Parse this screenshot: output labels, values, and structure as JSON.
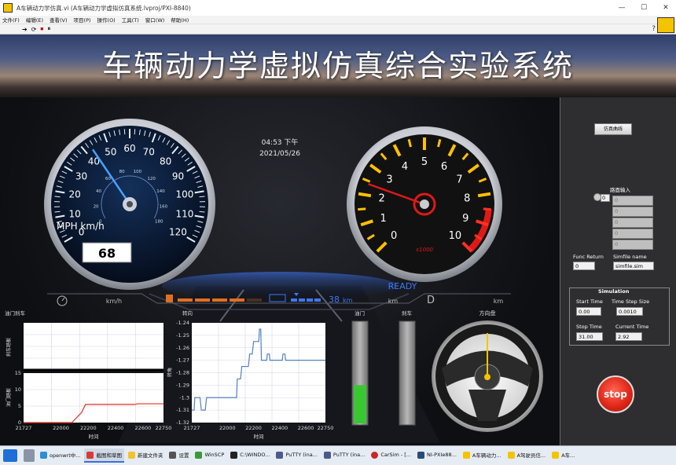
{
  "window": {
    "title": "A车辆动力学仿真.vi (A车辆动力学虚拟仿真系统.lvproj/PXI-8840)",
    "minimize": "—",
    "maximize": "☐",
    "close": "✕"
  },
  "menu": [
    "文件(F)",
    "编辑(E)",
    "查看(V)",
    "项目(P)",
    "操作(O)",
    "工具(T)",
    "窗口(W)",
    "帮助(H)"
  ],
  "toolbar": {
    "run": "➔",
    "run_continuous": "⟳",
    "abort": "⏹",
    "pause": "⏸",
    "help": "?"
  },
  "banner": {
    "title": "车辆动力学虚拟仿真综合实验系统"
  },
  "clock": {
    "time": "04:53 下午",
    "date": "2021/05/26"
  },
  "speedometer": {
    "outer_ticks": [
      "0",
      "10",
      "20",
      "30",
      "40",
      "50",
      "60",
      "70",
      "80",
      "90",
      "100",
      "110",
      "120"
    ],
    "inner_ticks": [
      "0",
      "20",
      "40",
      "60",
      "80",
      "100",
      "120",
      "140",
      "160",
      "180"
    ],
    "unit": "MPH km/h",
    "value": "68",
    "needle_mph": 43
  },
  "tachometer": {
    "ticks": [
      "0",
      "1",
      "2",
      "3",
      "4",
      "5",
      "6",
      "7",
      "8",
      "9",
      "10"
    ],
    "unit": "x1000",
    "value_k": 2.4
  },
  "status": {
    "ready": "READY",
    "speed_unit": "km/h",
    "range": "38",
    "range_unit": "km",
    "km": "km",
    "gear": "D",
    "km2": "km",
    "fuel_level": 0.72
  },
  "colors": {
    "accent_blue": "#3c78ff",
    "tick_red": "#ff2020",
    "tick_yellow": "#ffc000",
    "bar_orange": "#e07020",
    "bar_green": "#3ac832",
    "plot_line": "#e03020",
    "plot_line2": "#5080c0"
  },
  "chart_data": [
    {
      "type": "line",
      "title": "油门刹车",
      "ylabel": "刹车踏板",
      "xlabel": "时间",
      "x_ticks": [
        "21727",
        "22000",
        "22200",
        "22400",
        "22600",
        "22750"
      ],
      "ylim": [
        0,
        1
      ],
      "series": [
        {
          "values": [
            [
              21727,
              0
            ],
            [
              22750,
              0
            ]
          ]
        }
      ]
    },
    {
      "type": "line",
      "ylabel": "油门踏板",
      "xlabel": "时间",
      "y_ticks": [
        "15",
        "10",
        "5",
        "0"
      ],
      "x_ticks": [
        "21727",
        "22000",
        "22200",
        "22400",
        "22600",
        "22750"
      ],
      "ylim": [
        0,
        15
      ],
      "series": [
        {
          "values": [
            [
              21727,
              0
            ],
            [
              22080,
              0
            ],
            [
              22150,
              3
            ],
            [
              22180,
              5.5
            ],
            [
              22540,
              5.5
            ],
            [
              22560,
              5.7
            ],
            [
              22750,
              5.7
            ]
          ]
        }
      ]
    },
    {
      "type": "line",
      "title": "转向",
      "ylabel": "转角",
      "xlabel": "时间",
      "y_ticks": [
        "-1.24",
        "-1.25",
        "-1.26",
        "-1.27",
        "-1.28",
        "-1.29",
        "-1.3",
        "-1.31",
        "-1.32"
      ],
      "x_ticks": [
        "21727",
        "22000",
        "22200",
        "22400",
        "22600",
        "22750"
      ],
      "ylim": [
        -1.32,
        -1.24
      ],
      "series": [
        {
          "values": [
            [
              21727,
              -1.31
            ],
            [
              21745,
              -1.31
            ],
            [
              21750,
              -1.3
            ],
            [
              21790,
              -1.3
            ],
            [
              21800,
              -1.31
            ],
            [
              21830,
              -1.31
            ],
            [
              21840,
              -1.3
            ],
            [
              22070,
              -1.3
            ],
            [
              22075,
              -1.285
            ],
            [
              22100,
              -1.285
            ],
            [
              22110,
              -1.275
            ],
            [
              22160,
              -1.275
            ],
            [
              22170,
              -1.265
            ],
            [
              22190,
              -1.265
            ],
            [
              22200,
              -1.255
            ],
            [
              22240,
              -1.255
            ],
            [
              22245,
              -1.245
            ],
            [
              22255,
              -1.245
            ],
            [
              22260,
              -1.27
            ],
            [
              22300,
              -1.27
            ],
            [
              22305,
              -1.265
            ],
            [
              22320,
              -1.265
            ],
            [
              22325,
              -1.27
            ],
            [
              22420,
              -1.27
            ],
            [
              22425,
              -1.265
            ],
            [
              22440,
              -1.265
            ],
            [
              22445,
              -1.27
            ],
            [
              22750,
              -1.27
            ]
          ]
        }
      ]
    },
    {
      "type": "bar",
      "title": "油门",
      "values": [
        0.38
      ]
    },
    {
      "type": "bar",
      "title": "刹车",
      "values": [
        0.0
      ]
    }
  ],
  "steering": {
    "title": "方向盘"
  },
  "right_panel": {
    "sim_button": "仿真曲线",
    "path_input_label": "路面输入",
    "path_index": "0",
    "path_values": [
      "0",
      "0",
      "0",
      "0",
      "0"
    ],
    "func_return_label": "Func Return",
    "func_return": "0",
    "simfile_label": "Simfile name",
    "simfile": "simfile.sim",
    "sim_title": "Simulation",
    "start_time_label": "Start Time",
    "start_time": "0.00",
    "time_step_label": "Time Step Size",
    "time_step": "0.0010",
    "stop_time_label": "Stop Time",
    "stop_time": "31.00",
    "current_time_label": "Current Time",
    "current_time": "2.92",
    "stop_button": "stop"
  },
  "taskbar": [
    {
      "label": "openwrt中..."
    },
    {
      "label": "截图和草图",
      "active": true
    },
    {
      "label": "新建文件夹"
    },
    {
      "label": "设置"
    },
    {
      "label": "WinSCP"
    },
    {
      "label": "C:\\WINDO..."
    },
    {
      "label": "PuTTY (ina..."
    },
    {
      "label": "PuTTY (ina..."
    },
    {
      "label": "CarSim - [..."
    },
    {
      "label": "NI-PXIe88..."
    },
    {
      "label": "A车辆动力..."
    },
    {
      "label": "A驾驶员信..."
    },
    {
      "label": "A车..."
    }
  ]
}
